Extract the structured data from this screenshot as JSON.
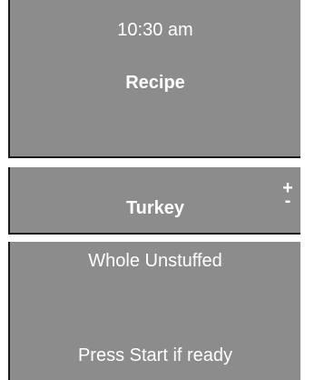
{
  "header": {
    "time": "10:30 am",
    "title": "Recipe"
  },
  "selection": {
    "item": "Turkey",
    "increase_symbol": "+",
    "decrease_symbol": "-"
  },
  "detail": {
    "variant": "Whole Unstuffed",
    "prompt": "Press Start if ready"
  },
  "colors": {
    "panel_background": "#8c8c8c",
    "panel_border": "#1a1a1a",
    "text": "#ffffff"
  }
}
